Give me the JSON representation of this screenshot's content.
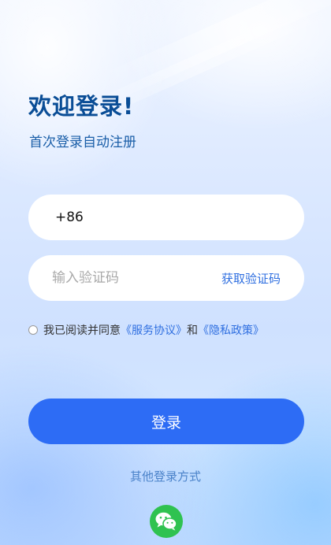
{
  "welcome_title": "欢迎登录!",
  "subtitle": "首次登录自动注册",
  "phone": {
    "prefix": "+86",
    "value": ""
  },
  "code": {
    "placeholder": "输入验证码",
    "get_code_label": "获取验证码"
  },
  "agreement": {
    "text": "我已阅读并同意",
    "service_link": "《服务协议》",
    "and": "和",
    "privacy_link": "《隐私政策》",
    "checked": false
  },
  "login_button": "登录",
  "other_login": "其他登录方式",
  "icons": {
    "wechat": "wechat-icon"
  },
  "colors": {
    "primary": "#2d6cf5",
    "link": "#2f6fe0",
    "title": "#0a4d96",
    "wechat": "#2fc250"
  }
}
